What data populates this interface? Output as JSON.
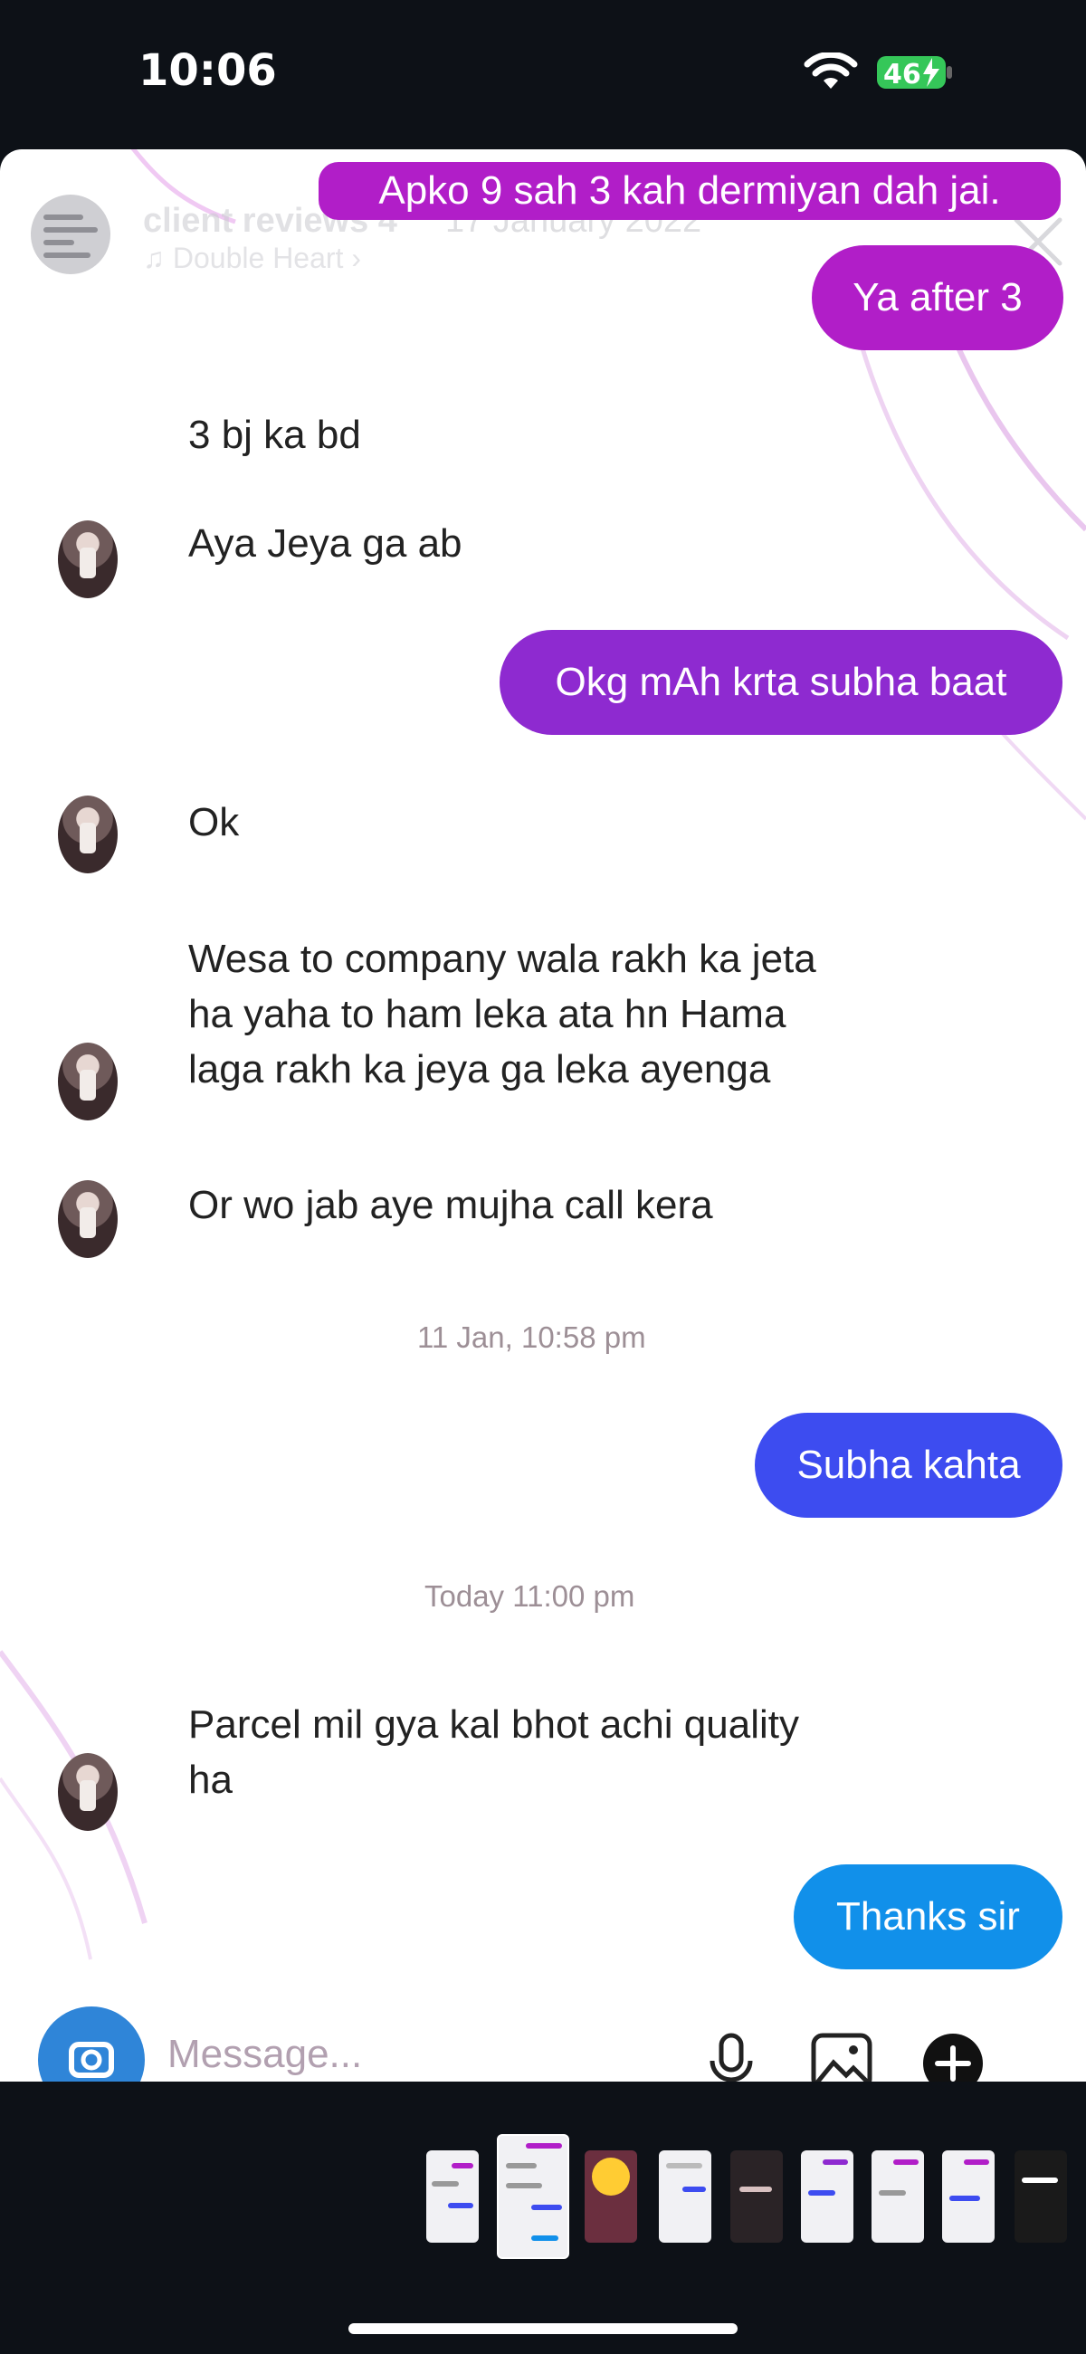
{
  "status_bar": {
    "time": "10:06",
    "battery": "46"
  },
  "story_header": {
    "account": "client reviews 4",
    "date": "17 January 2022",
    "music": "♫ Double Heart ›"
  },
  "chat": {
    "top_partial": "Apko 9 sah 3 kah dermiyan dah jai.",
    "sent": [
      {
        "text": "Ya after 3"
      },
      {
        "text": "Okg mAh krta subha baat"
      },
      {
        "text": "Subha kahta"
      },
      {
        "text": "Thanks sir"
      }
    ],
    "received": [
      {
        "text": "3 bj ka bd"
      },
      {
        "text": "Aya Jeya ga ab"
      },
      {
        "text": "Ok"
      },
      {
        "lines": [
          "Wesa to company wala rakh ka jeta",
          "ha yaha to ham leka ata hn Hama",
          "laga rakh ka jeya ga leka ayenga"
        ]
      },
      {
        "text": "Or wo jab aye mujha call kera"
      },
      {
        "lines": [
          "Parcel mil gya kal bhot achi quality",
          "ha"
        ]
      }
    ],
    "timestamps": [
      "11 Jan, 10:58 pm",
      "Today 11:00 pm"
    ],
    "composer_placeholder": "Message..."
  },
  "icons": {
    "wifi": "wifi-icon",
    "battery": "battery-charging-icon",
    "close": "close-icon",
    "camera": "camera-icon",
    "mic": "microphone-icon",
    "gallery": "gallery-icon",
    "plus": "plus-icon"
  },
  "colors": {
    "sent_purple": "#b11ec8",
    "sent_blue": "#3d4cf0",
    "sent_sky": "#1190ea",
    "battery_green": "#35c759"
  }
}
